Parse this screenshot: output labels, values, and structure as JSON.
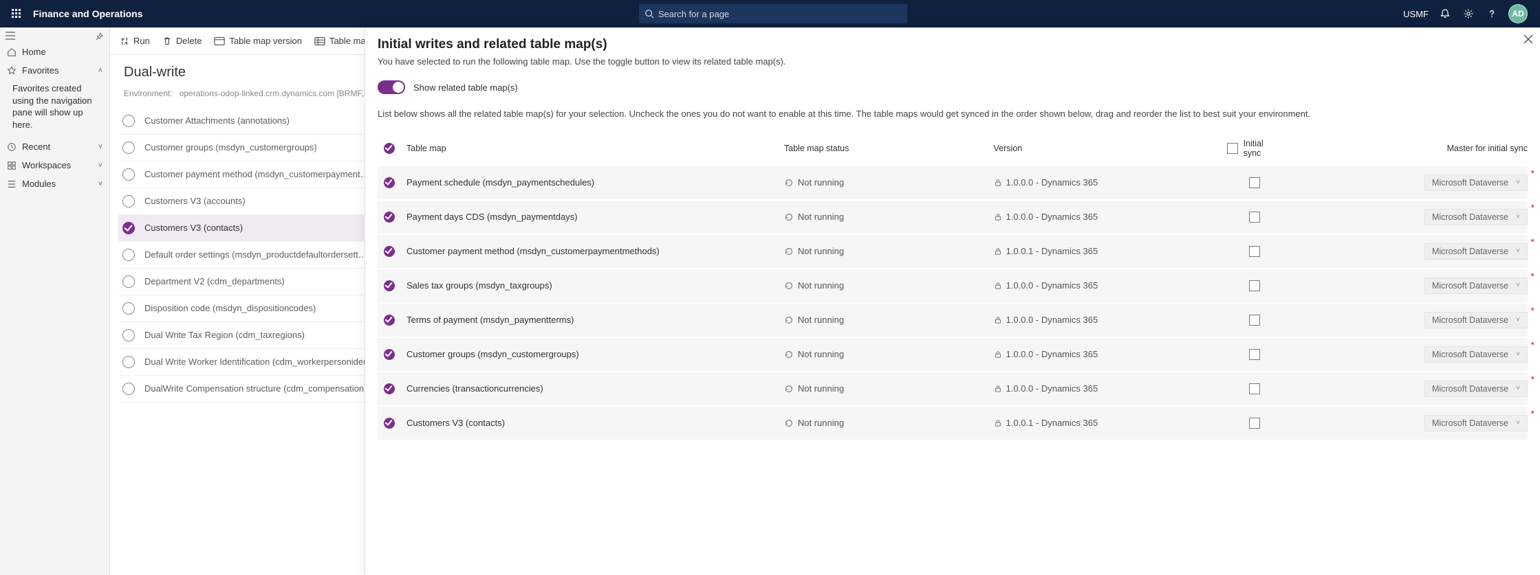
{
  "brand": "Finance and Operations",
  "search_placeholder": "Search for a page",
  "legal_entity": "USMF",
  "avatar_initials": "AD",
  "left_nav": {
    "home": "Home",
    "favorites": "Favorites",
    "favorites_note": "Favorites created using the navigation pane will show up here.",
    "recent": "Recent",
    "workspaces": "Workspaces",
    "modules": "Modules"
  },
  "commands": {
    "run": "Run",
    "delete": "Delete",
    "table_map_version": "Table map version",
    "table_mappings": "Table mappi…"
  },
  "page_title": "Dual-write",
  "environment_label": "Environment:",
  "environment_value": "operations-odop-linked.crm.dynamics.com [BRMF,DE…",
  "map_list": [
    {
      "label": "Customer Attachments (annotations)",
      "checked": false
    },
    {
      "label": "Customer groups (msdyn_customergroups)",
      "checked": false
    },
    {
      "label": "Customer payment method (msdyn_customerpayment…",
      "checked": false
    },
    {
      "label": "Customers V3 (accounts)",
      "checked": false
    },
    {
      "label": "Customers V3 (contacts)",
      "checked": true
    },
    {
      "label": "Default order settings (msdyn_productdefaultordersett…",
      "checked": false
    },
    {
      "label": "Department V2 (cdm_departments)",
      "checked": false
    },
    {
      "label": "Disposition code (msdyn_dispositioncodes)",
      "checked": false
    },
    {
      "label": "Dual Write Tax Region (cdm_taxregions)",
      "checked": false
    },
    {
      "label": "Dual Write Worker Identification (cdm_workerpersonidentificationnumbers)",
      "checked": false
    },
    {
      "label": "DualWrite Compensation structure (cdm_compensation…",
      "checked": false
    }
  ],
  "panel": {
    "title": "Initial writes and related table map(s)",
    "subtitle": "You have selected to run the following table map. Use the toggle button to view its related table map(s).",
    "toggle_label": "Show related table map(s)",
    "description": "List below shows all the related table map(s) for your selection. Uncheck the ones you do not want to enable at this time. The table maps would get synced in the order shown below, drag and reorder the list to best suit your environment.",
    "columns": {
      "map": "Table map",
      "status": "Table map status",
      "version": "Version",
      "initial_sync": "Initial sync",
      "master": "Master for initial sync"
    },
    "rows": [
      {
        "name": "Payment schedule (msdyn_paymentschedules)",
        "status": "Not running",
        "version": "1.0.0.0 - Dynamics 365",
        "master": "Microsoft Dataverse"
      },
      {
        "name": "Payment days CDS (msdyn_paymentdays)",
        "status": "Not running",
        "version": "1.0.0.0 - Dynamics 365",
        "master": "Microsoft Dataverse"
      },
      {
        "name": "Customer payment method (msdyn_customerpaymentmethods)",
        "status": "Not running",
        "version": "1.0.0.1 - Dynamics 365",
        "master": "Microsoft Dataverse"
      },
      {
        "name": "Sales tax groups (msdyn_taxgroups)",
        "status": "Not running",
        "version": "1.0.0.0 - Dynamics 365",
        "master": "Microsoft Dataverse"
      },
      {
        "name": "Terms of payment (msdyn_paymentterms)",
        "status": "Not running",
        "version": "1.0.0.0 - Dynamics 365",
        "master": "Microsoft Dataverse"
      },
      {
        "name": "Customer groups (msdyn_customergroups)",
        "status": "Not running",
        "version": "1.0.0.0 - Dynamics 365",
        "master": "Microsoft Dataverse"
      },
      {
        "name": "Currencies (transactioncurrencies)",
        "status": "Not running",
        "version": "1.0.0.0 - Dynamics 365",
        "master": "Microsoft Dataverse"
      },
      {
        "name": "Customers V3 (contacts)",
        "status": "Not running",
        "version": "1.0.0.1 - Dynamics 365",
        "master": "Microsoft Dataverse"
      }
    ]
  }
}
